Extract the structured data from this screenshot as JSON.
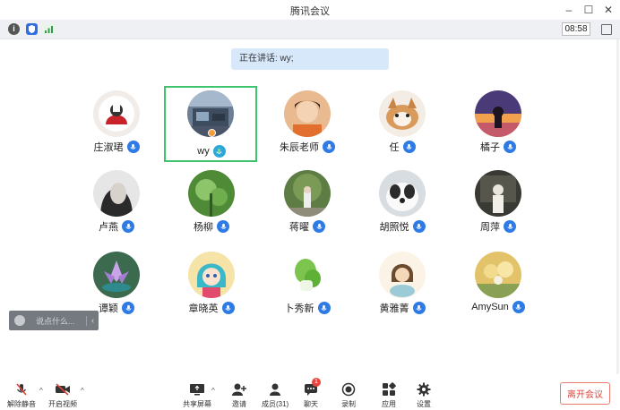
{
  "window": {
    "title": "腾讯会议"
  },
  "infobar": {
    "timer": "08:58"
  },
  "speaking": {
    "label": "正在讲话: wy;"
  },
  "participants": [
    {
      "name": "庄淑珺",
      "mic": "on"
    },
    {
      "name": "wy",
      "mic": "speaking",
      "active": true
    },
    {
      "name": "朱辰老师",
      "mic": "on"
    },
    {
      "name": "任",
      "mic": "on"
    },
    {
      "name": "橘子",
      "mic": "on"
    },
    {
      "name": "卢燕",
      "mic": "on"
    },
    {
      "name": "杨柳",
      "mic": "on"
    },
    {
      "name": "蒋曜",
      "mic": "on"
    },
    {
      "name": "胡照悦",
      "mic": "on"
    },
    {
      "name": "周萍",
      "mic": "on"
    },
    {
      "name": "谭颖",
      "mic": "on"
    },
    {
      "name": "章晓英",
      "mic": "on"
    },
    {
      "name": "卜秀新",
      "mic": "on"
    },
    {
      "name": "黄雅菁",
      "mic": "on"
    },
    {
      "name": "AmySun",
      "mic": "on"
    }
  ],
  "chat": {
    "placeholder": "说点什么..."
  },
  "toolbar": {
    "unmute": "解除静音",
    "start_video": "开启视频",
    "share_screen": "共享屏幕",
    "invite": "邀请",
    "members": "成员(31)",
    "chat": "聊天",
    "chat_badge": "1",
    "record": "录制",
    "apps": "应用",
    "settings": "设置",
    "leave": "离开会议"
  },
  "colors": {
    "active_border": "#3ec46d",
    "mic_blue": "#2f7be6",
    "leave_red": "#e0453b"
  }
}
